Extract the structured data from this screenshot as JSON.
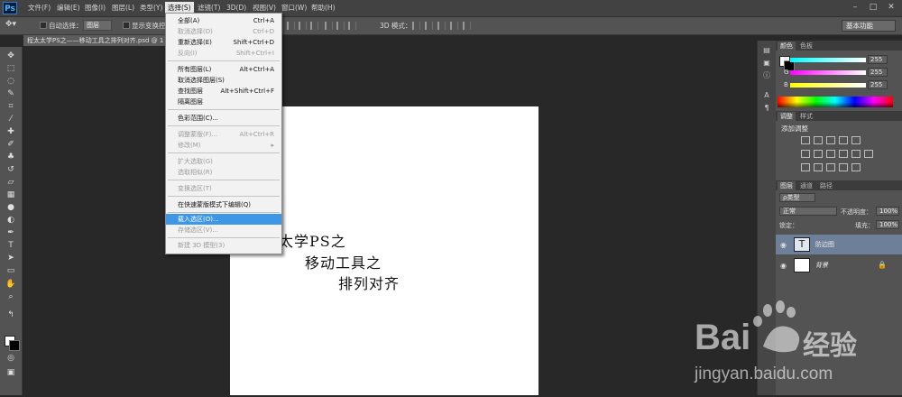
{
  "menubar": {
    "logo": "Ps",
    "items": [
      "文件(F)",
      "编辑(E)",
      "图像(I)",
      "图层(L)",
      "类型(Y)",
      "选择(S)",
      "滤镜(T)",
      "3D(D)",
      "视图(V)",
      "窗口(W)",
      "帮助(H)"
    ],
    "active_index": 5,
    "window_controls": [
      "–",
      "□",
      "✕"
    ]
  },
  "options_bar": {
    "auto_select_label": "自动选择：",
    "auto_select_value": "图层",
    "show_transform_label": "显示变换控",
    "three_d_mode_label": "3D 模式：",
    "workspace": "基本功能"
  },
  "document": {
    "tab_title": "程太太学PS之——移动工具之排列对齐.psd @ 1",
    "canvas_lines": [
      "太学PS之",
      "移动工具之",
      "排列对齐"
    ]
  },
  "select_menu": {
    "items": [
      {
        "label": "全部(A)",
        "shortcut": "Ctrl+A",
        "disabled": false
      },
      {
        "label": "取消选择(D)",
        "shortcut": "Ctrl+D",
        "disabled": true
      },
      {
        "label": "重新选择(E)",
        "shortcut": "Shift+Ctrl+D",
        "disabled": false
      },
      {
        "label": "反向(I)",
        "shortcut": "Shift+Ctrl+I",
        "disabled": true
      },
      {
        "label": "所有图层(L)",
        "shortcut": "Alt+Ctrl+A",
        "disabled": false
      },
      {
        "label": "取消选择图层(S)",
        "shortcut": "",
        "disabled": false
      },
      {
        "label": "查找图层",
        "shortcut": "Alt+Shift+Ctrl+F",
        "disabled": false
      },
      {
        "label": "隔离图层",
        "shortcut": "",
        "disabled": false
      },
      {
        "label": "色彩范围(C)...",
        "shortcut": "",
        "disabled": false
      },
      {
        "label": "调整蒙版(F)...",
        "shortcut": "Alt+Ctrl+R",
        "disabled": true
      },
      {
        "label": "修改(M)",
        "shortcut": "▸",
        "disabled": true
      },
      {
        "label": "扩大选取(G)",
        "shortcut": "",
        "disabled": true
      },
      {
        "label": "选取相似(R)",
        "shortcut": "",
        "disabled": true
      },
      {
        "label": "变换选区(T)",
        "shortcut": "",
        "disabled": true
      },
      {
        "label": "在快速蒙版模式下编辑(Q)",
        "shortcut": "",
        "disabled": false
      },
      {
        "label": "载入选区(O)...",
        "shortcut": "",
        "disabled": false,
        "highlight": true
      },
      {
        "label": "存储选区(V)...",
        "shortcut": "",
        "disabled": true
      },
      {
        "label": "新建 3D 模型(3)",
        "shortcut": "",
        "disabled": true
      }
    ]
  },
  "color_panel": {
    "tabs": [
      "颜色",
      "色板"
    ],
    "channels": [
      {
        "label": "R",
        "value": "255"
      },
      {
        "label": "G",
        "value": "255"
      },
      {
        "label": "B",
        "value": "255"
      }
    ]
  },
  "adjustments_panel": {
    "tabs": [
      "调整",
      "样式"
    ],
    "title": "添加调整"
  },
  "layers_panel": {
    "tabs": [
      "图层",
      "通道",
      "路径"
    ],
    "filter_label": "ρ类型",
    "blend_mode": "正常",
    "opacity_label": "不透明度：",
    "opacity_value": "100%",
    "lock_label": "锁定：",
    "fill_label": "填充：",
    "fill_value": "100%",
    "layers": [
      {
        "name": "防边图",
        "thumb": "T",
        "selected": true
      },
      {
        "name": "背景",
        "thumb": "",
        "selected": false
      }
    ]
  },
  "watermark": {
    "brand": "Bai",
    "brand_suffix": "经验",
    "url": "jingyan.baidu.com"
  }
}
